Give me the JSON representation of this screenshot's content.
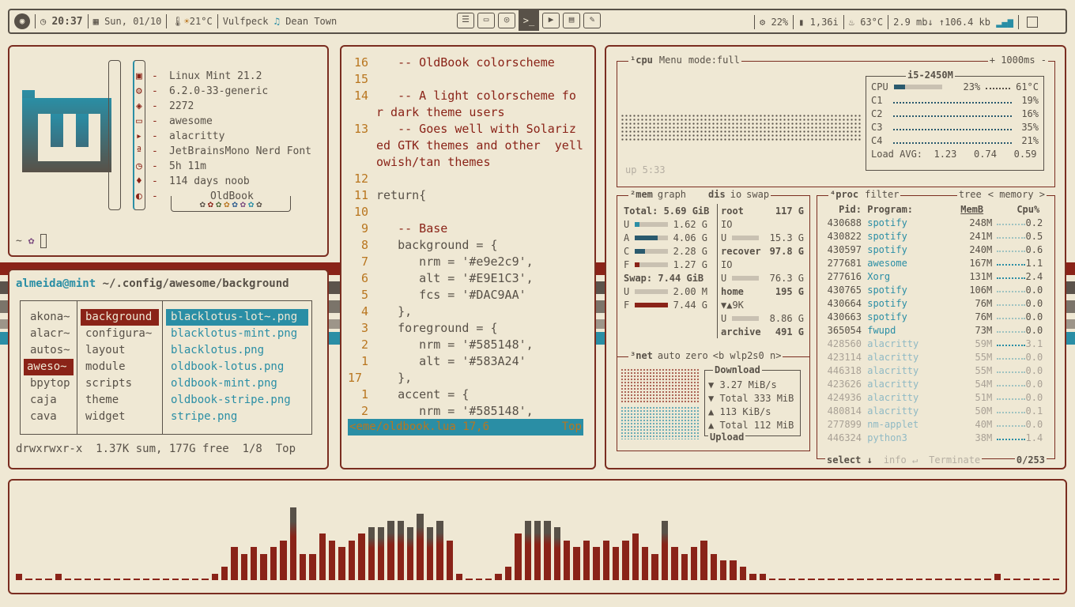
{
  "topbar": {
    "time": "20:37",
    "date": "Sun, 01/10",
    "temp": "21°C",
    "artist": "Vulfpeck",
    "track": "Dean Town",
    "cpu": "22%",
    "mem": "1,36i",
    "cputemp": "63°C",
    "down": "2.9 mb",
    "up": "106.4 kb"
  },
  "fetch": {
    "rows": [
      "Linux Mint 21.2",
      "6.2.0-33-generic",
      "2272",
      "awesome",
      "alacritty",
      "JetBrainsMono Nerd Font",
      "5h 11m",
      "114 days noob"
    ],
    "theme": "OldBook",
    "prompt": "~"
  },
  "fm": {
    "title_user": "almeida@mint",
    "title_path": "~/.config/awesome/background",
    "col1": [
      "akona~",
      "alacr~",
      "autos~",
      "aweso~",
      "bpytop",
      "caja",
      "cava"
    ],
    "col2": [
      "background",
      "configura~",
      "layout",
      "module",
      "scripts",
      "theme",
      "widget"
    ],
    "col3": [
      "blacklotus-lot~.png",
      "blacklotus-mint.png",
      "blacklotus.png",
      "oldbook-lotus.png",
      "oldbook-mint.png",
      "oldbook-stripe.png",
      "stripe.png"
    ],
    "status": "drwxrwxr-x  1.37K sum, 177G free  1/8  Top"
  },
  "editor": {
    "lines": [
      {
        "n": "16",
        "t": "   -- OldBook colorscheme"
      },
      {
        "n": "15",
        "t": ""
      },
      {
        "n": "14",
        "t": "   -- A light colorscheme fo"
      },
      {
        "n": "",
        "t": "r dark theme users"
      },
      {
        "n": "13",
        "t": "   -- Goes well with Solariz"
      },
      {
        "n": "",
        "t": "ed GTK themes and other  yell"
      },
      {
        "n": "",
        "t": "owish/tan themes"
      },
      {
        "n": "12",
        "t": ""
      },
      {
        "n": "11",
        "t": "return{"
      },
      {
        "n": "10",
        "t": ""
      },
      {
        "n": "9",
        "t": "   -- Base"
      },
      {
        "n": "8",
        "t": "   background = {"
      },
      {
        "n": "7",
        "t": "      nrm = '#e9e2c9',"
      },
      {
        "n": "6",
        "t": "      alt = '#E9E1C3',"
      },
      {
        "n": "5",
        "t": "      fcs = '#DAC9AA'"
      },
      {
        "n": "4",
        "t": "   },"
      },
      {
        "n": "3",
        "t": "   foreground = {"
      },
      {
        "n": "2",
        "t": "      nrm = '#585148',"
      },
      {
        "n": "1",
        "t": "      alt = '#583A24'"
      },
      {
        "n": "17",
        "t": "   },"
      },
      {
        "n": "1",
        "t": "   accent = {"
      },
      {
        "n": "2",
        "t": "      nrm = '#585148',"
      }
    ],
    "status_file": "<eme/oldbook.lua 17,6",
    "status_pos": "Top"
  },
  "btop": {
    "cpu_tabs": [
      "¹cpu",
      "Menu",
      "mode:full",
      "+ 1000ms -"
    ],
    "uptime": "up 5:33",
    "cpu_name": "i5-2450M",
    "cpu_total": "23%",
    "cpu_temp": "61°C",
    "cpu_fill": 0.23,
    "cores": [
      {
        "n": "C1",
        "v": "19%"
      },
      {
        "n": "C2",
        "v": "16%"
      },
      {
        "n": "C3",
        "v": "35%"
      },
      {
        "n": "C4",
        "v": "21%"
      }
    ],
    "load": "Load AVG:  1.23   0.74   0.59",
    "mem_tabs": [
      "²mem",
      "graph",
      "dis",
      "io",
      "swap"
    ],
    "mem_total": "Total:  5.69 GiB",
    "mem_rows": [
      {
        "k": "U",
        "v": "1.62 G",
        "f": 0.15
      },
      {
        "k": "A",
        "v": "4.06 G",
        "f": 0.7
      },
      {
        "k": "C",
        "v": "2.28 G",
        "f": 0.3
      },
      {
        "k": "F",
        "v": "1.27 G",
        "f": 0.15
      }
    ],
    "swap_total": "Swap:  7.44 GiB",
    "swap_rows": [
      {
        "k": "U",
        "v": "2.00 M",
        "f": 0.0
      },
      {
        "k": "F",
        "v": "7.44 G",
        "f": 1.0
      }
    ],
    "disks": [
      {
        "name": "root",
        "size": "117 G"
      },
      {
        "k": "IO",
        "v": ""
      },
      {
        "k": "U",
        "v": "15.3 G"
      },
      {
        "name": "recover",
        "size": "97.8 G"
      },
      {
        "k": "IO",
        "v": ""
      },
      {
        "k": "U",
        "v": "76.3 G"
      },
      {
        "name": "home",
        "size": "195 G"
      },
      {
        "k": "▼▲9K",
        "v": ""
      },
      {
        "k": "U",
        "v": "8.86 G"
      },
      {
        "name": "archive",
        "size": "491 G"
      }
    ],
    "net_tabs": [
      "³net",
      "auto",
      "zero",
      "<b wlp2s0 n>"
    ],
    "net_rows": [
      "Download",
      "▼ 3.27 MiB/s",
      "▼ Total   333 MiB",
      "▲ 113 KiB/s",
      "▲ Total   112 MiB",
      "Upload"
    ],
    "proc_tabs": [
      "⁴proc",
      "filter",
      "tree",
      "< memory >"
    ],
    "proc_head": [
      "Pid:",
      "Program:",
      "MemB",
      "Cpu%"
    ],
    "procs": [
      [
        "430688",
        "spotify",
        "248M",
        "0.2"
      ],
      [
        "430822",
        "spotify",
        "241M",
        "0.5"
      ],
      [
        "430597",
        "spotify",
        "240M",
        "0.6"
      ],
      [
        "277681",
        "awesome",
        "167M",
        "1.1"
      ],
      [
        "277616",
        "Xorg",
        "131M",
        "2.4"
      ],
      [
        "430765",
        "spotify",
        "106M",
        "0.0"
      ],
      [
        "430664",
        "spotify",
        "76M",
        "0.0"
      ],
      [
        "430663",
        "spotify",
        "76M",
        "0.0"
      ],
      [
        "365054",
        "fwupd",
        "73M",
        "0.0"
      ],
      [
        "428560",
        "alacritty",
        "59M",
        "3.1"
      ],
      [
        "423114",
        "alacritty",
        "55M",
        "0.0"
      ],
      [
        "446318",
        "alacritty",
        "55M",
        "0.0"
      ],
      [
        "423626",
        "alacritty",
        "54M",
        "0.0"
      ],
      [
        "424936",
        "alacritty",
        "51M",
        "0.0"
      ],
      [
        "480814",
        "alacritty",
        "50M",
        "0.1"
      ],
      [
        "277899",
        "nm-applet",
        "40M",
        "0.0"
      ],
      [
        "446324",
        "python3",
        "38M",
        "1.4"
      ]
    ],
    "proc_foot": [
      "select ↓",
      "info ↵",
      "Terminate",
      "0/253"
    ]
  },
  "cava": [
    1,
    0,
    0,
    0,
    1,
    0,
    0,
    0,
    0,
    0,
    0,
    0,
    0,
    0,
    0,
    0,
    0,
    0,
    0,
    0,
    1,
    2,
    5,
    4,
    5,
    4,
    5,
    6,
    11,
    4,
    4,
    7,
    6,
    5,
    6,
    7,
    8,
    8,
    9,
    9,
    8,
    10,
    8,
    9,
    6,
    1,
    0,
    0,
    0,
    1,
    2,
    7,
    9,
    9,
    9,
    8,
    6,
    5,
    6,
    5,
    6,
    5,
    6,
    7,
    5,
    4,
    9,
    5,
    4,
    5,
    6,
    4,
    3,
    3,
    2,
    1,
    1,
    0,
    0,
    0,
    0,
    0,
    0,
    0,
    0,
    0,
    0,
    0,
    0,
    0,
    0,
    0,
    0,
    0,
    0,
    0,
    0,
    0,
    0,
    0,
    1,
    0,
    0,
    0,
    0,
    0,
    0
  ]
}
